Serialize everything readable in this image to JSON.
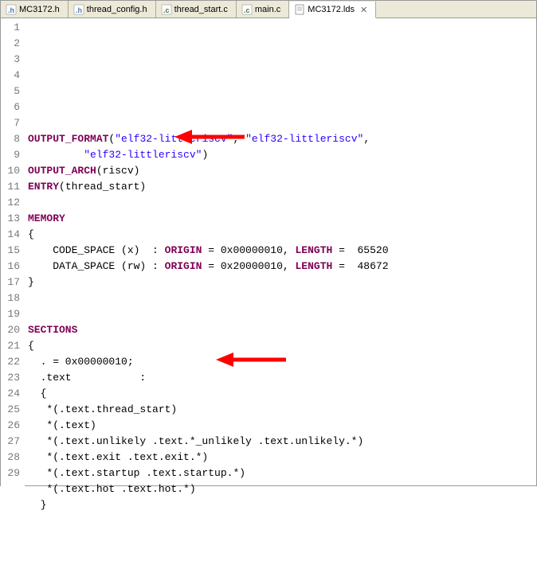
{
  "tabs": [
    {
      "filename": "MC3172.h",
      "icon": "h",
      "active": false
    },
    {
      "filename": "thread_config.h",
      "icon": "h",
      "active": false
    },
    {
      "filename": "thread_start.c",
      "icon": "c",
      "active": false
    },
    {
      "filename": "main.c",
      "icon": "c",
      "active": false
    },
    {
      "filename": "MC3172.lds",
      "icon": "generic",
      "active": true
    }
  ],
  "lines": [
    "",
    "",
    "OUTPUT_FORMAT(\"elf32-littleriscv\", \"elf32-littleriscv\",",
    "         \"elf32-littleriscv\")",
    "OUTPUT_ARCH(riscv)",
    "ENTRY(thread_start)",
    "",
    "MEMORY",
    "{",
    "    CODE_SPACE (x)  : ORIGIN = 0x00000010, LENGTH =  65520",
    "    DATA_SPACE (rw) : ORIGIN = 0x20000010, LENGTH =  48672",
    "}",
    "",
    "",
    "SECTIONS",
    "{",
    "  . = 0x00000010;",
    "  .text           :",
    "  {",
    "   *(.text.thread_start)",
    "   *(.text)",
    "   *(.text.unlikely .text.*_unlikely .text.unlikely.*)",
    "   *(.text.exit .text.exit.*)",
    "   *(.text.startup .text.startup.*)",
    "   *(.text.hot .text.hot.*)",
    "  }",
    "",
    "",
    ""
  ],
  "annotations": {
    "arrow1_target_line": 6,
    "arrow2_target_line": 20
  }
}
